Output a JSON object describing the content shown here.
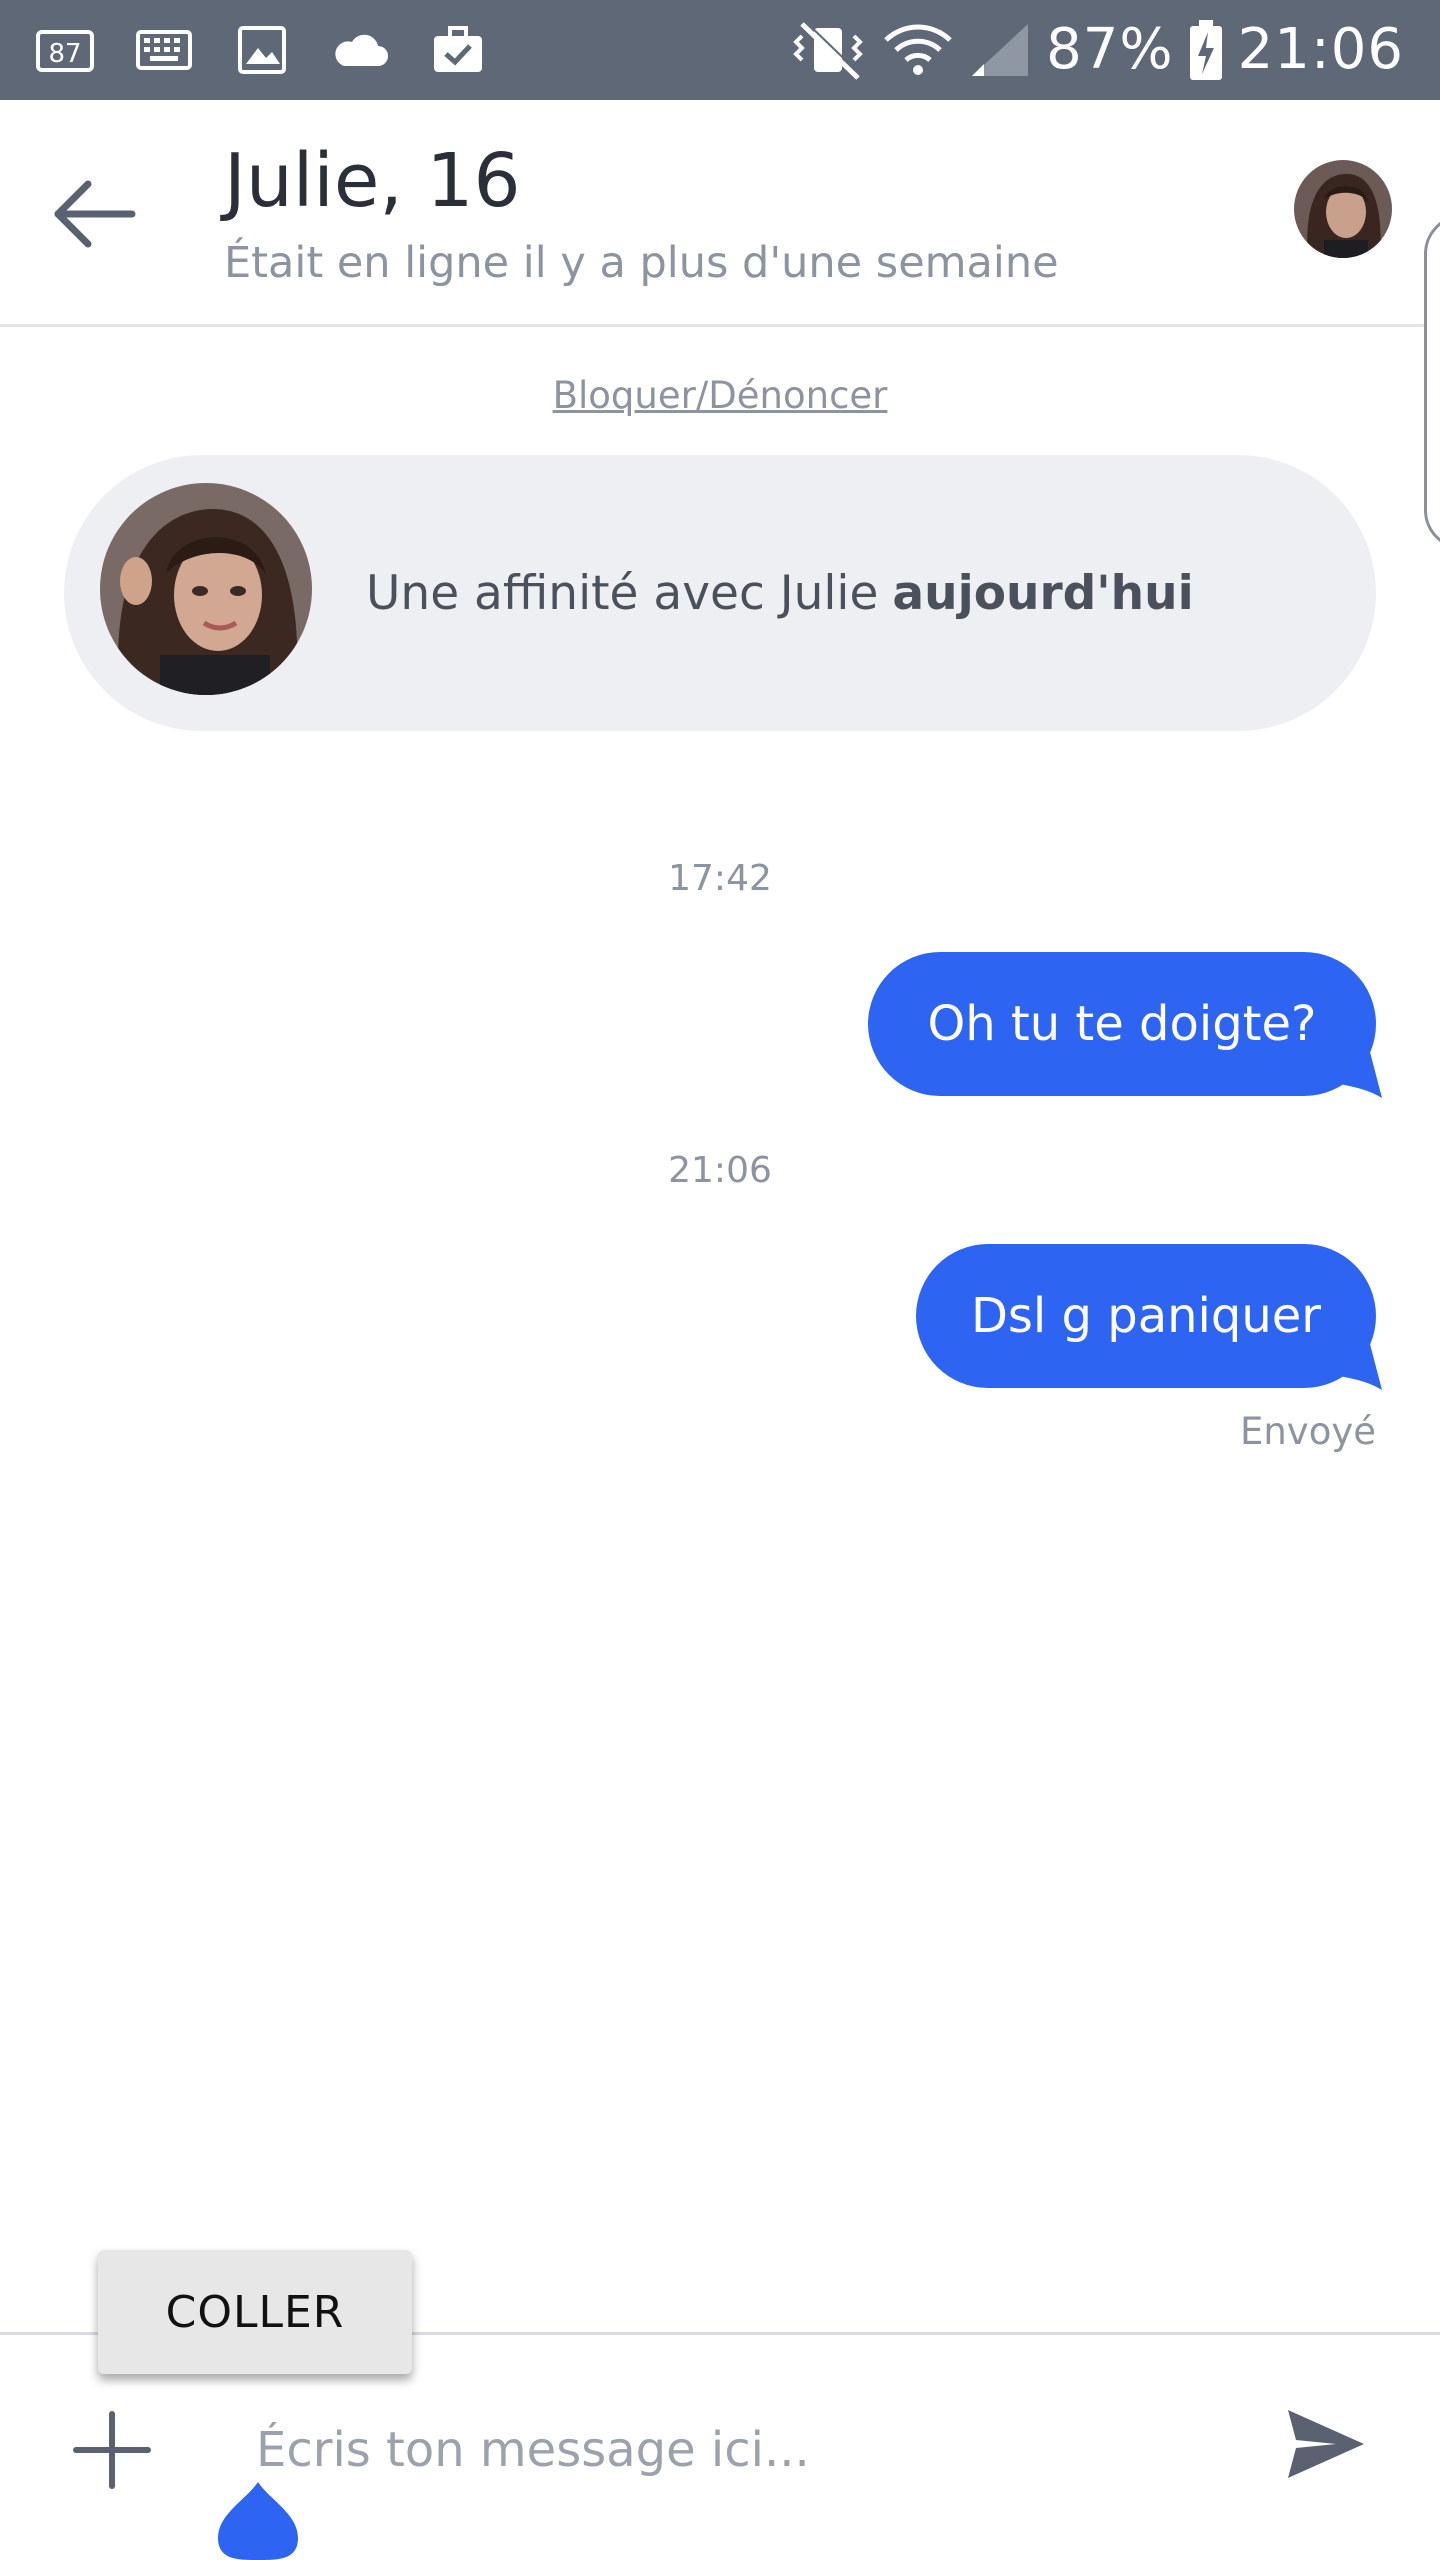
{
  "status_bar": {
    "left_icons": [
      "notification-count-icon",
      "keyboard-icon",
      "image-icon",
      "cloud-icon",
      "briefcase-check-icon"
    ],
    "notification_count": "87",
    "battery_percent": "87%",
    "time": "21:06"
  },
  "header": {
    "title": "Julie, 16",
    "subtitle": "Était en ligne il y a plus d'une semaine"
  },
  "chat": {
    "block_report_label": "Bloquer/Dénoncer",
    "affinity_prefix": "Une affinité avec Julie",
    "affinity_emphasis": "aujourd'hui",
    "messages": [
      {
        "time": "17:42",
        "text": "Oh tu te doigte?"
      },
      {
        "time": "21:06",
        "text": "Dsl g paniquer"
      }
    ],
    "sent_status": "Envoyé"
  },
  "composer": {
    "paste_label": "COLLER",
    "placeholder": "Écris ton message ici..."
  },
  "colors": {
    "status_bar_bg": "#5f6877",
    "bubble_blue": "#2d65f2",
    "affinity_bg": "#eeeff3",
    "muted_text": "#8c93a1"
  }
}
